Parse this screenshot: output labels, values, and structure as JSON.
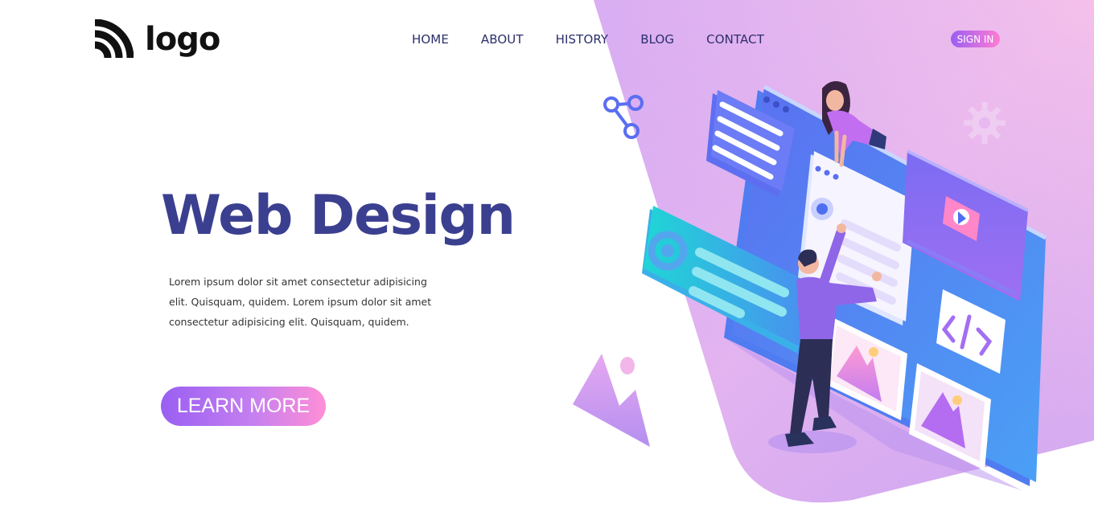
{
  "header": {
    "logo_text": "logo",
    "logo_icon": "signal-waves-icon",
    "nav": [
      {
        "label": "HOME"
      },
      {
        "label": "ABOUT"
      },
      {
        "label": "HISTORY"
      },
      {
        "label": "BLOG"
      },
      {
        "label": "CONTACT"
      }
    ],
    "signin_label": "SIGN IN"
  },
  "hero": {
    "title": "Web Design",
    "description": "Lorem ipsum dolor sit amet consectetur adipisicing elit. Quisquam, quidem. Lorem ipsum dolor sit amet consectetur adipisicing elit. Quisquam, quidem.",
    "cta_label": "LEARN MORE"
  },
  "colors": {
    "accent_purple": "#9a5ff2",
    "accent_pink": "#ff7cd3",
    "title": "#3b3f8f",
    "nav_text": "#2b2f6b",
    "bg_gradient_start": "#cfa6f5",
    "bg_gradient_end": "#f7c3ea"
  }
}
